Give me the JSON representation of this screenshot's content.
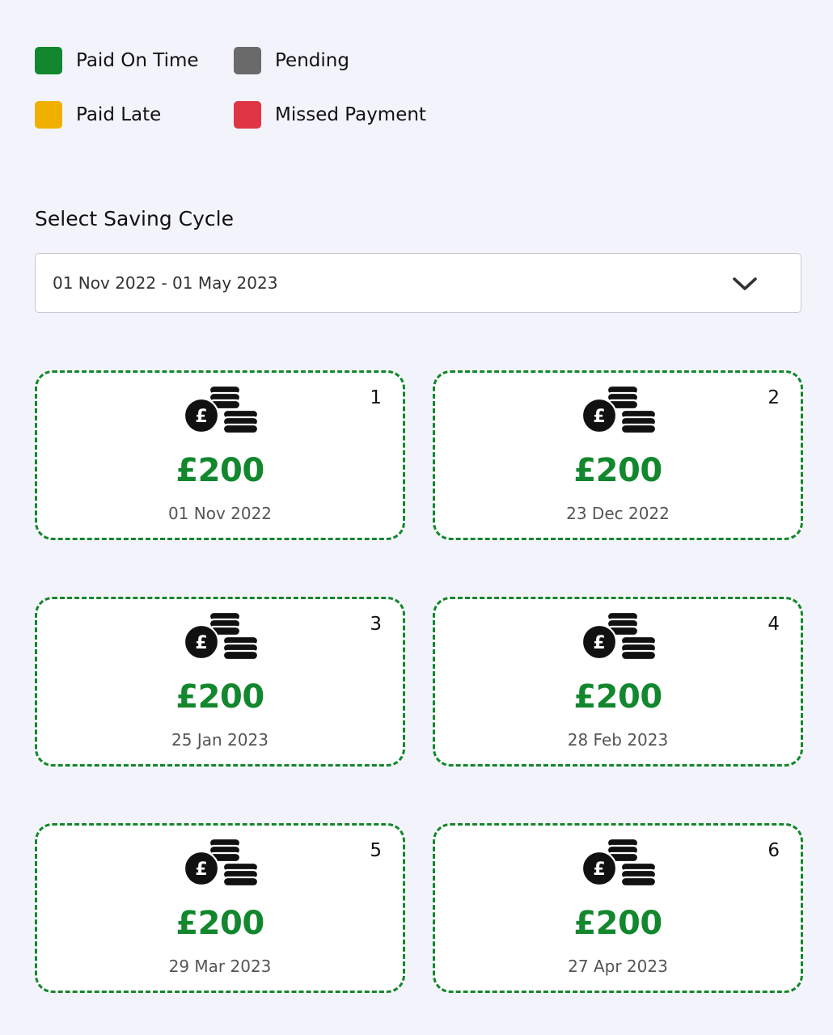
{
  "legend": [
    {
      "label": "Paid On Time",
      "color": "#12872d"
    },
    {
      "label": "Pending",
      "color": "#6a6a6a"
    },
    {
      "label": "Paid Late",
      "color": "#efb000"
    },
    {
      "label": "Missed Payment",
      "color": "#e03545"
    }
  ],
  "saving_cycle": {
    "title": "Select Saving Cycle",
    "selected": "01 Nov 2022 - 01 May 2023",
    "dropdown_icon": "chevron-down-icon"
  },
  "payments": [
    {
      "number": "1",
      "amount": "£200",
      "date": "01 Nov 2022",
      "status_color": "#12872d",
      "icon": "pound-coins-icon"
    },
    {
      "number": "2",
      "amount": "£200",
      "date": "23 Dec 2022",
      "status_color": "#12872d",
      "icon": "pound-coins-icon"
    },
    {
      "number": "3",
      "amount": "£200",
      "date": "25 Jan 2023",
      "status_color": "#12872d",
      "icon": "pound-coins-icon"
    },
    {
      "number": "4",
      "amount": "£200",
      "date": "28 Feb 2023",
      "status_color": "#12872d",
      "icon": "pound-coins-icon"
    },
    {
      "number": "5",
      "amount": "£200",
      "date": "29 Mar 2023",
      "status_color": "#12872d",
      "icon": "pound-coins-icon"
    },
    {
      "number": "6",
      "amount": "£200",
      "date": "27 Apr 2023",
      "status_color": "#12872d",
      "icon": "pound-coins-icon"
    }
  ]
}
